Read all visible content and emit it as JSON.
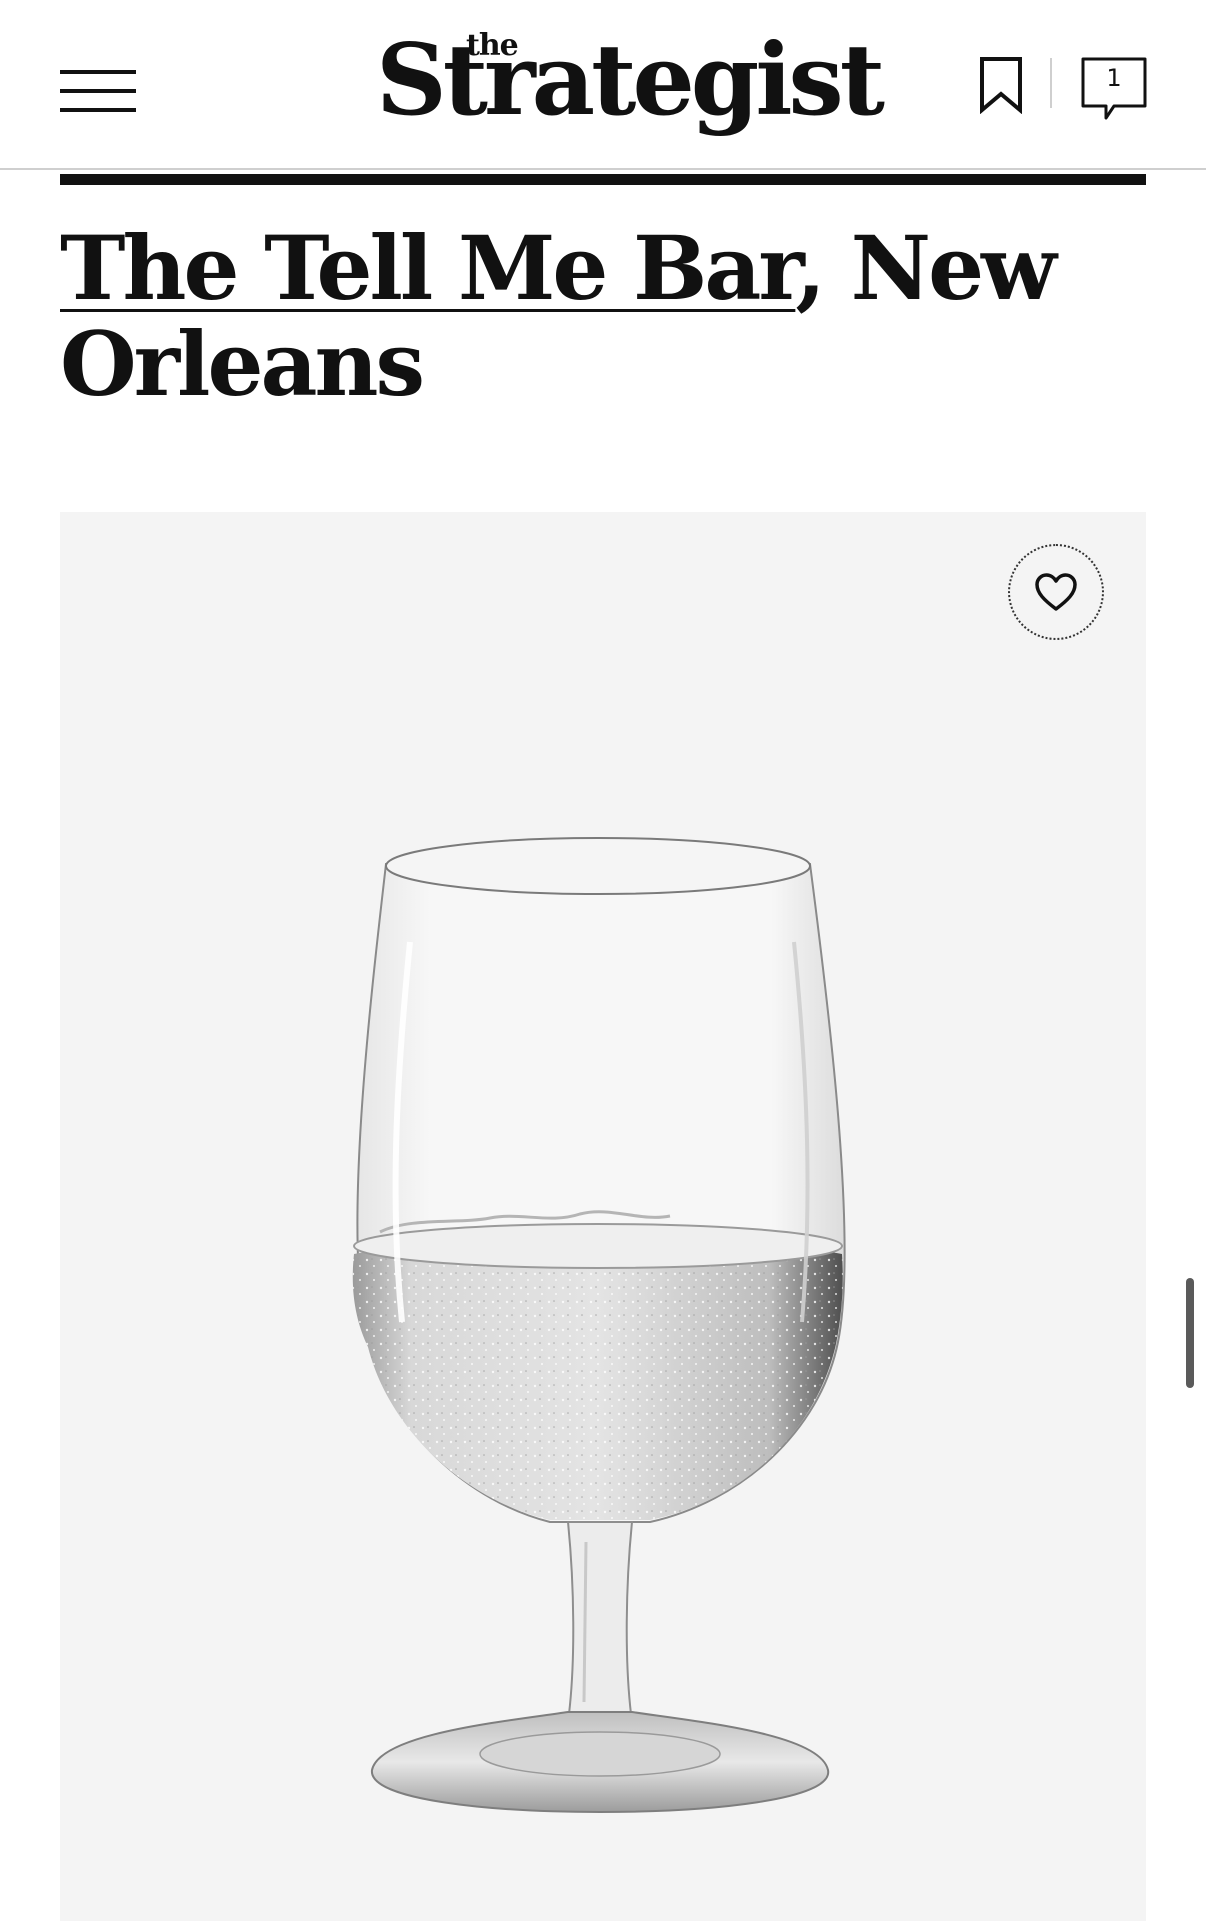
{
  "header": {
    "logo_small": "the",
    "logo_main": "Strategist",
    "comments_count": "1"
  },
  "article": {
    "headline_link": "The Tell Me Bar",
    "headline_rest": ", New Orleans"
  },
  "icons": {
    "menu": "hamburger-menu-icon",
    "bookmark": "bookmark-icon",
    "comments": "comment-bubble-icon",
    "favorite": "heart-icon"
  },
  "colors": {
    "text": "#111111",
    "card_background": "#f4f4f4",
    "divider": "#cfcfcf"
  }
}
